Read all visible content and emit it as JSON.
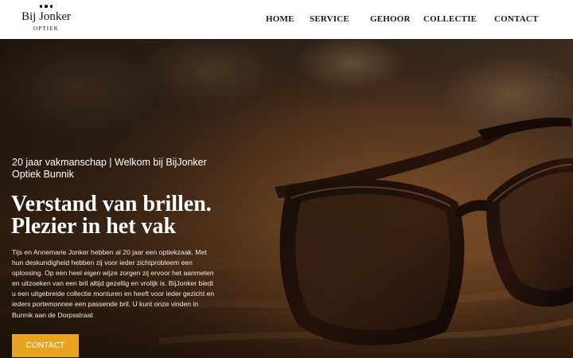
{
  "header": {
    "logo": {
      "name": "Bij Jonker",
      "subtitle": "OPTIEK"
    },
    "nav": [
      {
        "label": "HOME"
      },
      {
        "label": "SERVICE"
      },
      {
        "label": "GEHOOR"
      },
      {
        "label": "COLLECTIE"
      },
      {
        "label": "CONTACT"
      }
    ]
  },
  "hero": {
    "eyebrow": "20 jaar vakmanschap | Welkom bij BijJonker Optiek Bunnik",
    "headline_line1": "Verstand van brillen.",
    "headline_line2": "Plezier in het vak",
    "body": "Tijs en Annemarie Jonker hebben al 20 jaar een optiekzaak. Met hun deskundigheid hebben zij voor ieder zichtprobleem een oplossing. Op een heel eigen wijze zorgen zij ervoor het aanmeten en uitzoeken van een bril altijd gezellig en vrolijk is. BijJonker biedt u een uitgebreide collectie monturen en heeft voor ieder gezicht en ieders portemonnee een passende bril. U kunt onze vinden in Bunnik aan de Dorpsstraat",
    "cta_label": "CONTACT",
    "image_subject": "black-rectangular-eyeglasses-on-wooden-table"
  },
  "colors": {
    "header_bg": "#ffffff",
    "cta_bg": "#e8a321",
    "text_light": "#ffffff"
  }
}
